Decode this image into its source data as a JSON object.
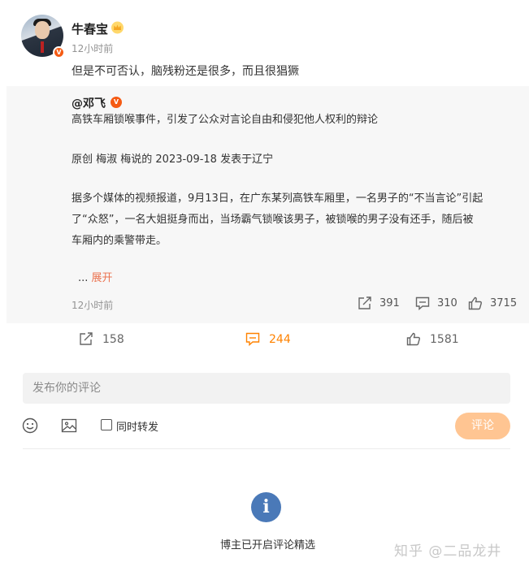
{
  "post": {
    "author": "牛春宝",
    "time": "12小时前",
    "text": "但是不可否认，脑残粉还是很多，而且很猖獗",
    "verified_badge": "V"
  },
  "repost": {
    "author": "@邓飞",
    "verified_badge": "V",
    "lines": [
      "高铁车厢锁喉事件，引发了公众对言论自由和侵犯他人权利的辩论",
      "原创  梅淑  梅说的  2023-09-18 发表于辽宁",
      "据多个媒体的视频报道，9月13日，在广东某列高铁车厢里，一名男子的“不当言论”引起",
      "了“众怒”，一名大姐挺身而出，当场霸气锁喉该男子，被锁喉的男子没有还手，随后被",
      "车厢内的乘警带走。"
    ],
    "more_prefix": "...",
    "more_label": "展开",
    "time": "12小时前",
    "share_count": "391",
    "comment_count": "310",
    "like_count": "3715"
  },
  "actions": {
    "share_count": "158",
    "comment_count": "244",
    "like_count": "1581"
  },
  "compose": {
    "placeholder": "发布你的评论",
    "also_repost_label": "同时转发",
    "submit_label": "评论"
  },
  "notice": {
    "icon": "i",
    "text": "博主已开启评论精选"
  },
  "watermark": "知乎 @二品龙井",
  "colors": {
    "accent": "#ff8200",
    "link": "#eb7350",
    "submit_disabled": "#ffc592",
    "info_icon": "#4a79b8"
  }
}
